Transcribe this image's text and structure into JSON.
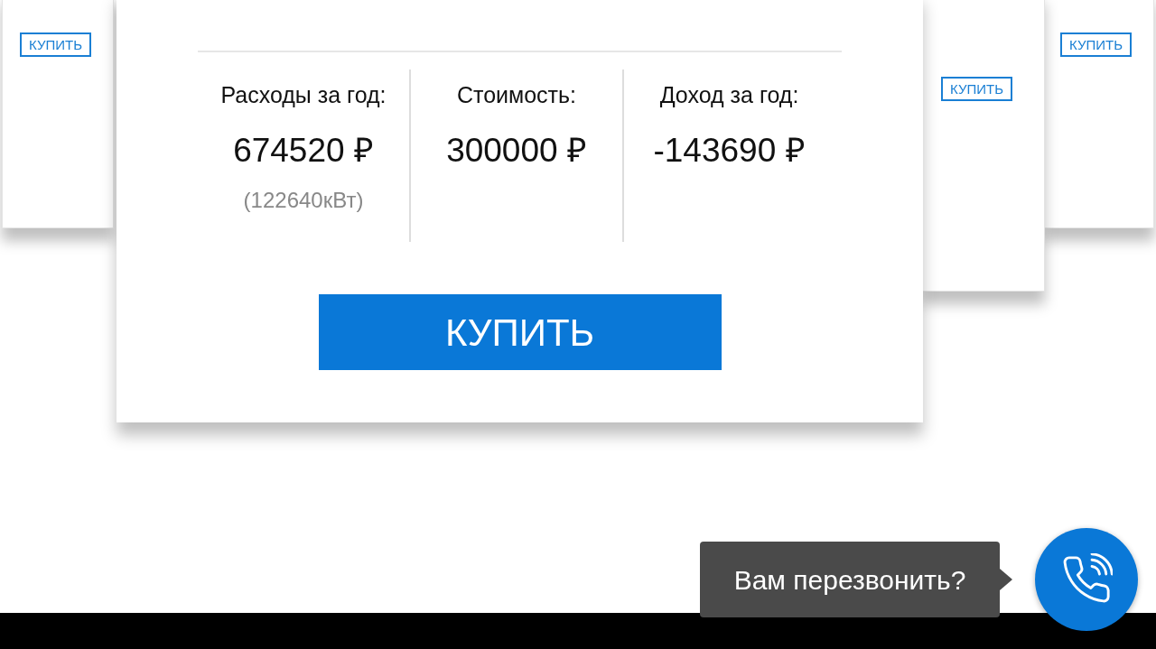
{
  "side_cards": [
    {
      "button": "КУПИТЬ"
    },
    {
      "button": "КУПИТЬ"
    },
    {
      "button": "КУПИТЬ"
    }
  ],
  "main_card": {
    "stats": [
      {
        "label": "Расходы за год:",
        "value": "674520 ₽",
        "note": "(122640кВт)"
      },
      {
        "label": "Стоимость:",
        "value": "300000 ₽"
      },
      {
        "label": "Доход за год:",
        "value": "-143690 ₽"
      }
    ],
    "buy_button": "КУПИТЬ"
  },
  "callback": {
    "tooltip": "Вам перезвонить?"
  }
}
